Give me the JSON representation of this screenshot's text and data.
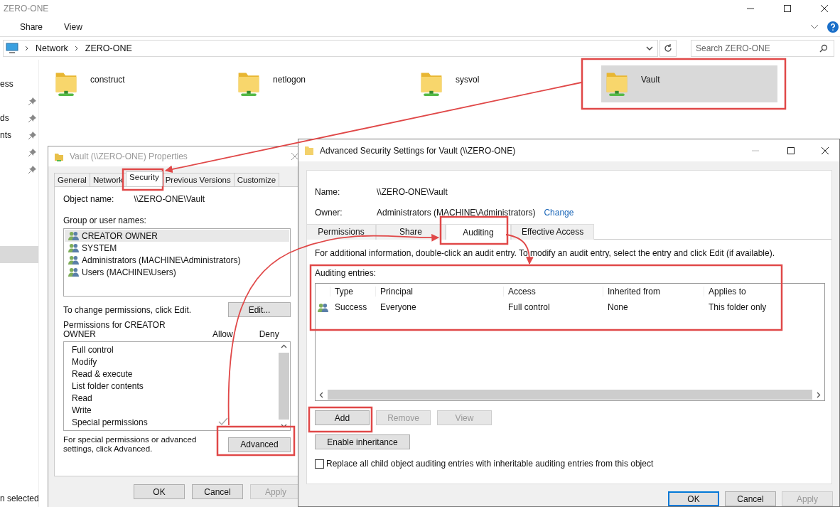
{
  "explorer": {
    "title": "ZERO-ONE",
    "ribbon_tabs": [
      "Share",
      "View"
    ],
    "breadcrumb": [
      "Network",
      "ZERO-ONE"
    ],
    "search": {
      "placeholder": "Search ZERO-ONE"
    },
    "sidebar": {
      "items": [
        {
          "label": "ess",
          "pinned": false,
          "selected": false
        },
        {
          "pinned": true,
          "selected": false
        },
        {
          "label": "ds",
          "pinned": true,
          "selected": false
        },
        {
          "label": "nts",
          "pinned": true,
          "selected": false
        },
        {
          "pinned": true,
          "selected": false
        },
        {
          "pinned": true,
          "selected": false
        },
        {
          "pinned": false,
          "selected": false
        },
        {
          "pinned": false,
          "selected": false
        },
        {
          "pinned": false,
          "selected": false
        },
        {
          "pinned": false,
          "selected": false
        },
        {
          "pinned": false,
          "selected": true
        }
      ]
    },
    "folders": [
      {
        "name": "construct",
        "selected": false
      },
      {
        "name": "netlogon",
        "selected": false
      },
      {
        "name": "sysvol",
        "selected": false
      },
      {
        "name": "Vault",
        "selected": true
      }
    ],
    "status_bar": "n selected"
  },
  "properties": {
    "title": "Vault (\\\\ZERO-ONE) Properties",
    "tabs": [
      {
        "label": "General",
        "selected": false
      },
      {
        "label": "Network",
        "selected": false
      },
      {
        "label": "Security",
        "selected": true
      },
      {
        "label": "Previous Versions",
        "selected": false
      },
      {
        "label": "Customize",
        "selected": false
      }
    ],
    "object_name_label": "Object name:",
    "object_name": "\\\\ZERO-ONE\\Vault",
    "groups_label": "Group or user names:",
    "users": [
      {
        "name": "CREATOR OWNER",
        "selected": true
      },
      {
        "name": "SYSTEM",
        "selected": false
      },
      {
        "name": "Administrators (MACHINE\\Administrators)",
        "selected": false
      },
      {
        "name": "Users (MACHINE\\Users)",
        "selected": false
      }
    ],
    "change_note": "To change permissions, click Edit.",
    "edit_button": "Edit...",
    "permissions_label": "Permissions for CREATOR OWNER",
    "allow_label": "Allow",
    "deny_label": "Deny",
    "permissions": [
      {
        "name": "Full control",
        "allow": false
      },
      {
        "name": "Modify",
        "allow": false
      },
      {
        "name": "Read & execute",
        "allow": false
      },
      {
        "name": "List folder contents",
        "allow": false
      },
      {
        "name": "Read",
        "allow": false
      },
      {
        "name": "Write",
        "allow": false
      },
      {
        "name": "Special permissions",
        "allow": true
      }
    ],
    "advanced_note": "For special permissions or advanced settings, click Advanced.",
    "advanced_button": "Advanced",
    "buttons": [
      {
        "label": "OK",
        "disabled": false
      },
      {
        "label": "Cancel",
        "disabled": false
      },
      {
        "label": "Apply",
        "disabled": true
      }
    ]
  },
  "advanced": {
    "title": "Advanced Security Settings for Vault (\\\\ZERO-ONE)",
    "name_label": "Name:",
    "name": "\\\\ZERO-ONE\\Vault",
    "owner_label": "Owner:",
    "owner": "Administrators (MACHINE\\Administrators)",
    "change_link": "Change",
    "tabs": [
      {
        "label": "Permissions",
        "selected": false
      },
      {
        "label": "Share",
        "selected": false
      },
      {
        "label": "Auditing",
        "selected": true
      },
      {
        "label": "Effective Access",
        "selected": false
      }
    ],
    "info": "For additional information, double-click an audit entry. To modify an audit entry, select the entry and click Edit (if available).",
    "entries_label": "Auditing entries:",
    "table": {
      "columns": [
        "Type",
        "Principal",
        "Access",
        "Inherited from",
        "Applies to"
      ],
      "rows": [
        [
          "Success",
          "Everyone",
          "Full control",
          "None",
          "This folder only"
        ]
      ]
    },
    "entry_buttons": [
      {
        "label": "Add",
        "disabled": false
      },
      {
        "label": "Remove",
        "disabled": true
      },
      {
        "label": "View",
        "disabled": true
      }
    ],
    "inheritance_button": "Enable inheritance",
    "replace_checkbox": {
      "label": "Replace all child object auditing entries with inheritable auditing entries from this object",
      "checked": false
    },
    "buttons": [
      {
        "label": "OK",
        "disabled": false,
        "default": true
      },
      {
        "label": "Cancel",
        "disabled": false,
        "default": false
      },
      {
        "label": "Apply",
        "disabled": true,
        "default": false
      }
    ]
  }
}
